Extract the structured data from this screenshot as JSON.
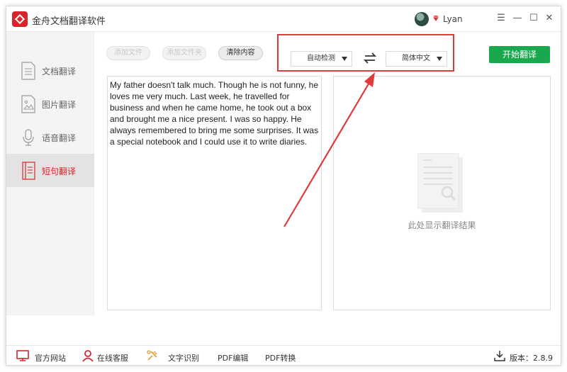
{
  "app": {
    "title": "金舟文档翻译软件",
    "username": "Lyan"
  },
  "window_controls": {
    "menu": "☰",
    "minimize": "—",
    "maximize": "☐",
    "close": "✕"
  },
  "sidebar": {
    "items": [
      {
        "label": "文档翻译",
        "icon": "document-icon"
      },
      {
        "label": "图片翻译",
        "icon": "image-icon"
      },
      {
        "label": "语音翻译",
        "icon": "microphone-icon"
      },
      {
        "label": "短句翻译",
        "icon": "notebook-icon",
        "active": true
      }
    ]
  },
  "toolbar": {
    "add_file": "添加文件",
    "add_folder": "添加文件夹",
    "clear": "清除内容",
    "source_lang": "自动检测",
    "target_lang": "简体中文",
    "start": "开始翻译"
  },
  "source_text": "My father doesn't talk much. Though he is not funny, he loves me very much. Last week, he travelled for business and when he came home, he took out a box and brought me a nice present. I was so happy. He always remembered to bring me some surprises. It was a special notebook and I could use it to write diaries.",
  "result": {
    "placeholder": "此处显示翻译结果"
  },
  "statusbar": {
    "website": "官方网站",
    "support": "在线客服",
    "ocr": "文字识别",
    "pdf_edit": "PDF编辑",
    "pdf_convert": "PDF转换",
    "version": "版本：2.8.9"
  },
  "colors": {
    "brand": "#d9252a",
    "start_button": "#19a84d",
    "annotation": "#e23a3a"
  }
}
